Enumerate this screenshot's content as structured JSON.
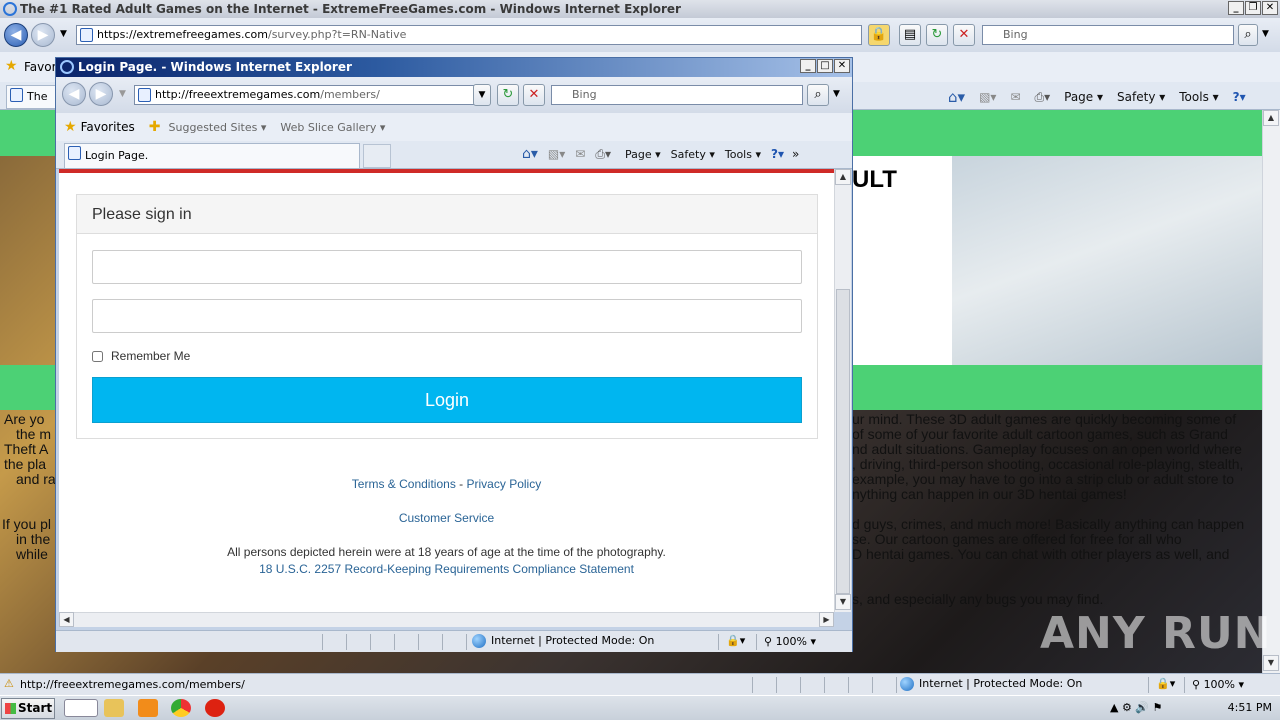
{
  "main_window": {
    "title": "The #1 Rated Adult Games on the Internet - ExtremeFreeGames.com - Windows Internet Explorer",
    "address_domain": "https://extremefreegames.com",
    "address_path": "/survey.php?t=RN-Native",
    "search_placeholder": "Bing",
    "favorites_label": "Favori",
    "tab_label": "The #",
    "commands": [
      "Page",
      "Safety",
      "Tools"
    ],
    "page_heading_fragment": "ULT",
    "bg_text_1": "ur mind. These 3D adult games are quickly becoming some of",
    "bg_text_2": "of some of your favorite adult cartoon games, such as Grand",
    "bg_text_3": "nd adult situations. Gameplay focuses on an open world where",
    "bg_text_4": ", driving, third-person shooting, occasional role-playing, stealth,",
    "bg_text_5": "example, you may have to go into a strip club or adult store to",
    "bg_text_6": "nything can happen in our 3D hentai games!",
    "bg_text_7": "d guys, crimes, and much more! Basically anything can happen",
    "bg_text_8": "se. Our cartoon games are offered for free for all who",
    "bg_text_9": "D hentai games. You can chat with other players as well, and",
    "bg_text_10": "s, and especially any bugs you may find.",
    "left_text": [
      "Are yo",
      "the m",
      "Theft A",
      "the pla",
      "and ra",
      "If you pl",
      "in the",
      "while"
    ],
    "status_url": "http://freeextremegames.com/members/",
    "status_zone": "Internet | Protected Mode: On",
    "zoom": "100%"
  },
  "popup": {
    "title": "Login Page. - Windows Internet Explorer",
    "address_domain": "http://freeextremegames.com",
    "address_path": "/members/",
    "search_placeholder": "Bing",
    "favorites_label": "Favorites",
    "suggested_sites": "Suggested Sites",
    "web_slice_gallery": "Web Slice Gallery",
    "tab_label": "Login Page.",
    "commands": [
      "Page",
      "Safety",
      "Tools"
    ],
    "status_zone": "Internet | Protected Mode: On",
    "zoom": "100%"
  },
  "login": {
    "heading": "Please sign in",
    "username_value": "",
    "password_value": "",
    "remember_label": "Remember Me",
    "remember_checked": false,
    "button_label": "Login",
    "terms_link": "Terms & Conditions",
    "separator": "-",
    "privacy_link": "Privacy Policy",
    "customer_service": "Customer Service",
    "age_statement": "All persons depicted herein were at 18 years of age at the time of the photography.",
    "compliance_link": "18 U.S.C. 2257 Record-Keeping Requirements Compliance Statement"
  },
  "taskbar": {
    "start_label": "Start",
    "clock": "4:51 PM"
  },
  "watermark": "ANY RUN",
  "colors": {
    "login_button": "#00b6f0",
    "top_accent": "#cf2a27",
    "site_green": "#4cd175",
    "link_blue": "#2a6496"
  }
}
